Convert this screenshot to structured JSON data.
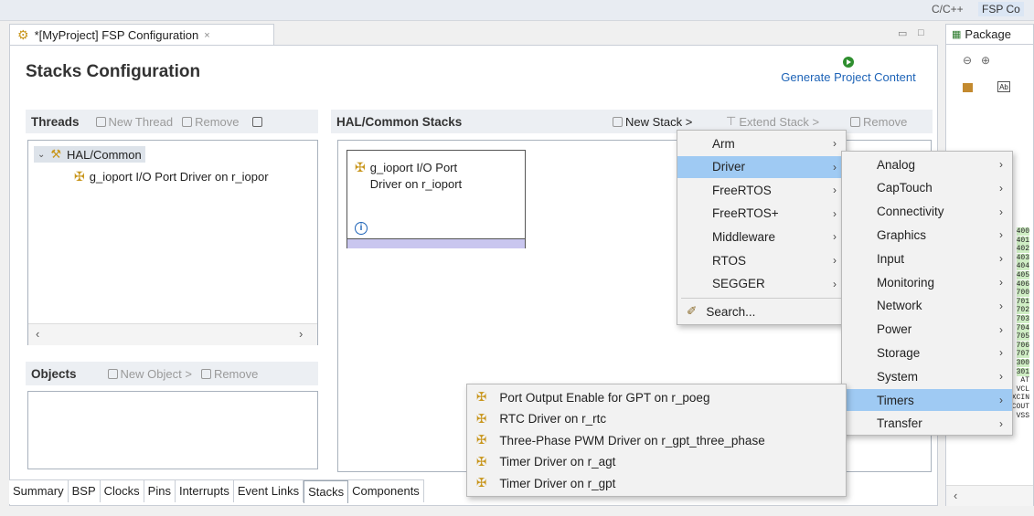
{
  "toolbar": {
    "right_text": "C/C++",
    "perspective": "FSP Co"
  },
  "editor_tab": {
    "label": "*[MyProject] FSP Configuration",
    "close": "×"
  },
  "title": "Stacks Configuration",
  "generate": {
    "label": "Generate Project Content"
  },
  "threads": {
    "header": "Threads",
    "new_thread": "New Thread",
    "remove": "Remove",
    "tree": {
      "root": "HAL/Common",
      "child": "g_ioport I/O Port Driver on r_iopor"
    }
  },
  "objects": {
    "header": "Objects",
    "new_object": "New Object >",
    "remove": "Remove"
  },
  "stacks": {
    "header": "HAL/Common Stacks",
    "new_stack": "New Stack >",
    "extend_stack": "Extend Stack >",
    "remove": "Remove",
    "block": {
      "line1": "g_ioport I/O Port",
      "line2": "Driver on r_ioport",
      "info": "i"
    }
  },
  "menu1": {
    "items": [
      "Arm",
      "Driver",
      "FreeRTOS",
      "FreeRTOS+",
      "Middleware",
      "RTOS",
      "SEGGER"
    ],
    "search": "Search...",
    "selected": "Driver"
  },
  "menu2": {
    "items": [
      "Analog",
      "CapTouch",
      "Connectivity",
      "Graphics",
      "Input",
      "Monitoring",
      "Network",
      "Power",
      "Storage",
      "System",
      "Timers",
      "Transfer"
    ],
    "selected": "Timers"
  },
  "menu3": {
    "items": [
      "Port Output Enable for GPT on r_poeg",
      "RTC Driver on r_rtc",
      "Three-Phase PWM Driver on r_gpt_three_phase",
      "Timer Driver on r_agt",
      "Timer Driver on r_gpt"
    ]
  },
  "bottom_tabs": [
    "Summary",
    "BSP",
    "Clocks",
    "Pins",
    "Interrupts",
    "Event Links",
    "Stacks",
    "Components"
  ],
  "package": {
    "label": "Package",
    "pins": [
      "400",
      "401",
      "402",
      "403",
      "404",
      "405",
      "406",
      "700",
      "701",
      "702",
      "703",
      "704",
      "705",
      "706",
      "707",
      "300",
      "301",
      "AT",
      "VCL",
      "XCIN",
      "XCOUT",
      "VSS"
    ]
  }
}
